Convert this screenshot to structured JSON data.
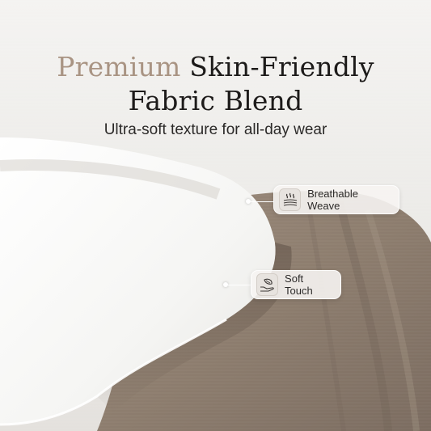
{
  "headline": {
    "accent_word": "Premium",
    "line1_rest": "Skin-Friendly",
    "line2": "Fabric Blend"
  },
  "subtitle": "Ultra-soft texture for all-day wear",
  "features": [
    {
      "label": "Breathable Weave",
      "icon": "breathable-weave-icon"
    },
    {
      "label": "Soft Touch",
      "icon": "soft-touch-icon"
    }
  ],
  "colors": {
    "accent": "#a99483",
    "text": "#1d1b1a",
    "fabric_white": "#f6f6f4",
    "fabric_taupe": "#8d7d6e",
    "background": "#eeecea"
  }
}
